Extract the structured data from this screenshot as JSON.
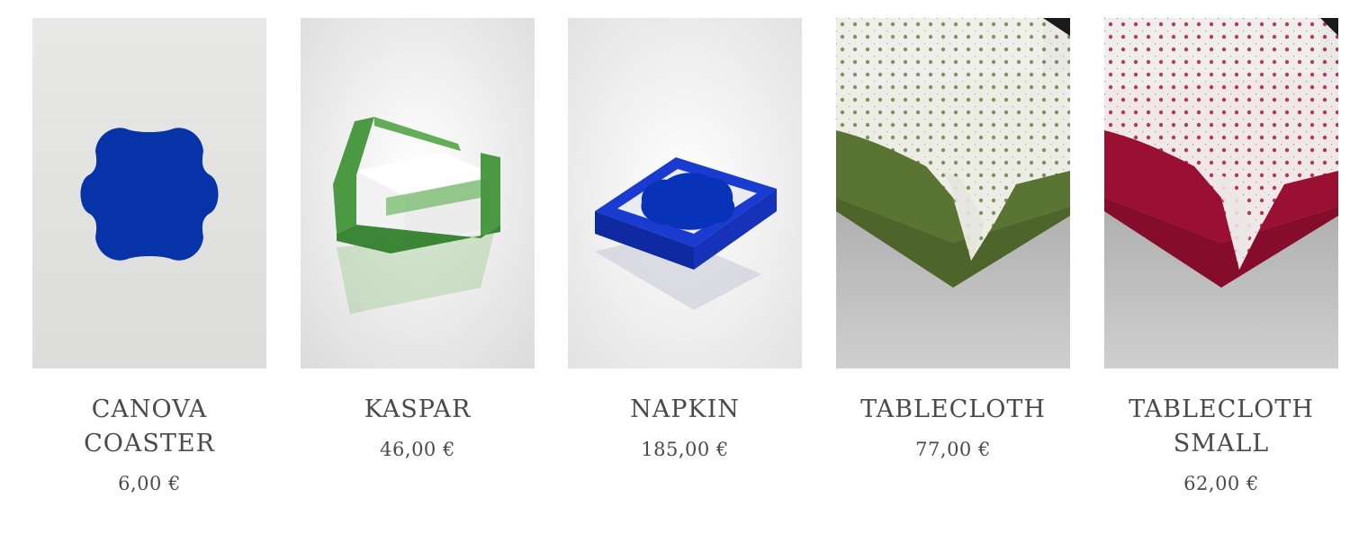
{
  "products": [
    {
      "name": "CANOVA COASTER",
      "price": "6,00 €",
      "image": "blue-coaster-image",
      "accent": "#0733a8"
    },
    {
      "name": "KASPAR",
      "price": "46,00 €",
      "image": "green-napkin-holder-image",
      "accent": "#3a8a2a"
    },
    {
      "name": "NAPKIN",
      "price": "185,00 €",
      "image": "blue-napkin-box-image",
      "accent": "#1430b8"
    },
    {
      "name": "TABLECLOTH",
      "price": "77,00 €",
      "image": "green-lace-tablecloth-image",
      "accent": "#5c7a36"
    },
    {
      "name": "TABLECLOTH SMALL",
      "price": "62,00 €",
      "image": "red-lace-tablecloth-image",
      "accent": "#a11638"
    }
  ]
}
